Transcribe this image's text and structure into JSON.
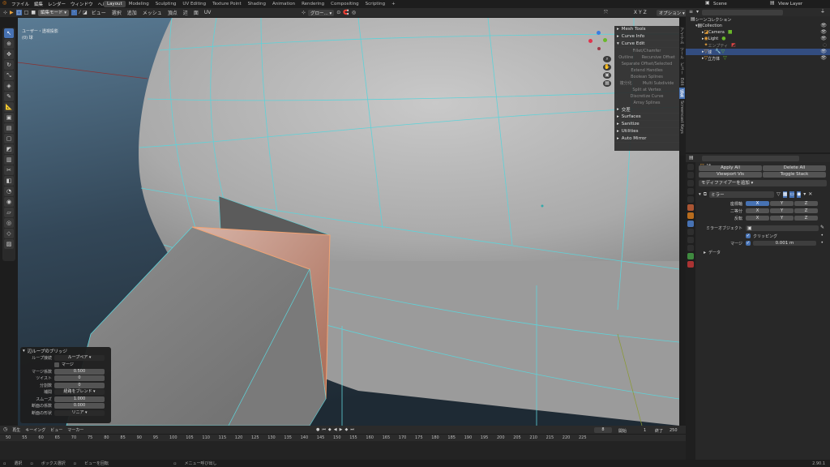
{
  "topbar": {
    "menus": [
      "ファイル",
      "編集",
      "レンダー",
      "ウィンドウ",
      "ヘルプ"
    ],
    "tabs": [
      "Layout",
      "Modeling",
      "Sculpting",
      "UV Editing",
      "Texture Point",
      "Shading",
      "Animation",
      "Rendering",
      "Compositing",
      "Scripting"
    ],
    "active_tab": "Layout",
    "scene": "Scene",
    "view_layer": "View Layer"
  },
  "viewport_header": {
    "mode": "編集モード",
    "menus": [
      "ビュー",
      "選択",
      "追加",
      "メッシュ",
      "頂点",
      "辺",
      "面",
      "UV"
    ],
    "transform_orientation": "グロー...",
    "axes": [
      "X",
      "Y",
      "Z"
    ],
    "options": "オプション"
  },
  "viewport": {
    "view_name": "ユーザー・透視投影",
    "object_name": "(0) 球"
  },
  "npanel": {
    "sections": [
      {
        "label": "Mesh Tools",
        "open": false
      },
      {
        "label": "Curve Info",
        "open": false
      },
      {
        "label": "Curve Edit",
        "open": true
      }
    ],
    "curve_edit_buttons": [
      "Fillet/Chamfer",
      "Outline",
      "Recursive Offset",
      "Separate Offset/Selected",
      "Extend Handles",
      "Boolean Splines",
      "複分化",
      "Multi Subdivide",
      "Split at Vertex",
      "Discretize Curve",
      "Array Splines"
    ],
    "sections2": [
      "交差",
      "Surfaces",
      "Sanitize",
      "Utilities",
      "Auto Mirror"
    ],
    "tabs": [
      "アイテム",
      "ツール",
      "ビュー",
      "Edit",
      "編集",
      "Screencast Keys"
    ]
  },
  "redo_panel": {
    "title": "辺ループのブリッジ",
    "rows": [
      {
        "label": "ループ接続",
        "value": "ループペア"
      },
      {
        "label": "",
        "value": "マージ",
        "checkbox": true
      },
      {
        "label": "マージ係数",
        "value": "0.500"
      },
      {
        "label": "ツイスト",
        "value": "0"
      },
      {
        "label": "分割数",
        "value": "0"
      },
      {
        "label": "補間",
        "value": "経路をブレンド"
      },
      {
        "label": "スムーズ",
        "value": "1.000"
      },
      {
        "label": "断面の係数",
        "value": "0.000"
      },
      {
        "label": "断面の形状",
        "value": "リニア"
      }
    ]
  },
  "timeline": {
    "menus": [
      "再生",
      "キーイング",
      "ビュー",
      "マーカー"
    ],
    "current_frame": "8",
    "start_label": "開始",
    "start": "1",
    "end_label": "終了",
    "end": "250",
    "ticks": [
      "50",
      "55",
      "60",
      "65",
      "70",
      "75",
      "80",
      "85",
      "90",
      "95",
      "100",
      "105",
      "110",
      "115",
      "120",
      "125",
      "130",
      "135",
      "140",
      "145",
      "150",
      "155",
      "160",
      "165",
      "170",
      "175",
      "180",
      "185",
      "190",
      "195",
      "200",
      "205",
      "210",
      "215",
      "220",
      "225"
    ]
  },
  "statusbar": {
    "items": [
      "選択",
      "ボックス選択",
      "ビューを回転",
      "メニュー呼び出し"
    ],
    "version": "2.90.1"
  },
  "outliner": {
    "root": "シーンコレクション",
    "items": [
      {
        "label": "Collection",
        "indent": 1
      },
      {
        "label": "Camera",
        "indent": 2
      },
      {
        "label": "Light",
        "indent": 2
      },
      {
        "label": "エンプティ",
        "indent": 2
      },
      {
        "label": "球",
        "indent": 2,
        "selected": true
      },
      {
        "label": "立方体",
        "indent": 2
      }
    ]
  },
  "properties": {
    "object": "球",
    "apply_all": "Apply All",
    "delete_all": "Delete All",
    "viewport_vis": "Viewport Vis",
    "toggle_stack": "Toggle Stack",
    "add_modifier": "モディファイアーを追加",
    "modifier_name": "ミラー",
    "axis_label": "座標軸",
    "bisect_label": "二等分",
    "flip_label": "反転",
    "axes": [
      "X",
      "Y",
      "Z"
    ],
    "mirror_object_label": "ミラーオブジェクト",
    "clipping_label": "クリッピング",
    "merge_label": "マージ",
    "merge_value": "0.001 m",
    "data_label": "データ"
  }
}
